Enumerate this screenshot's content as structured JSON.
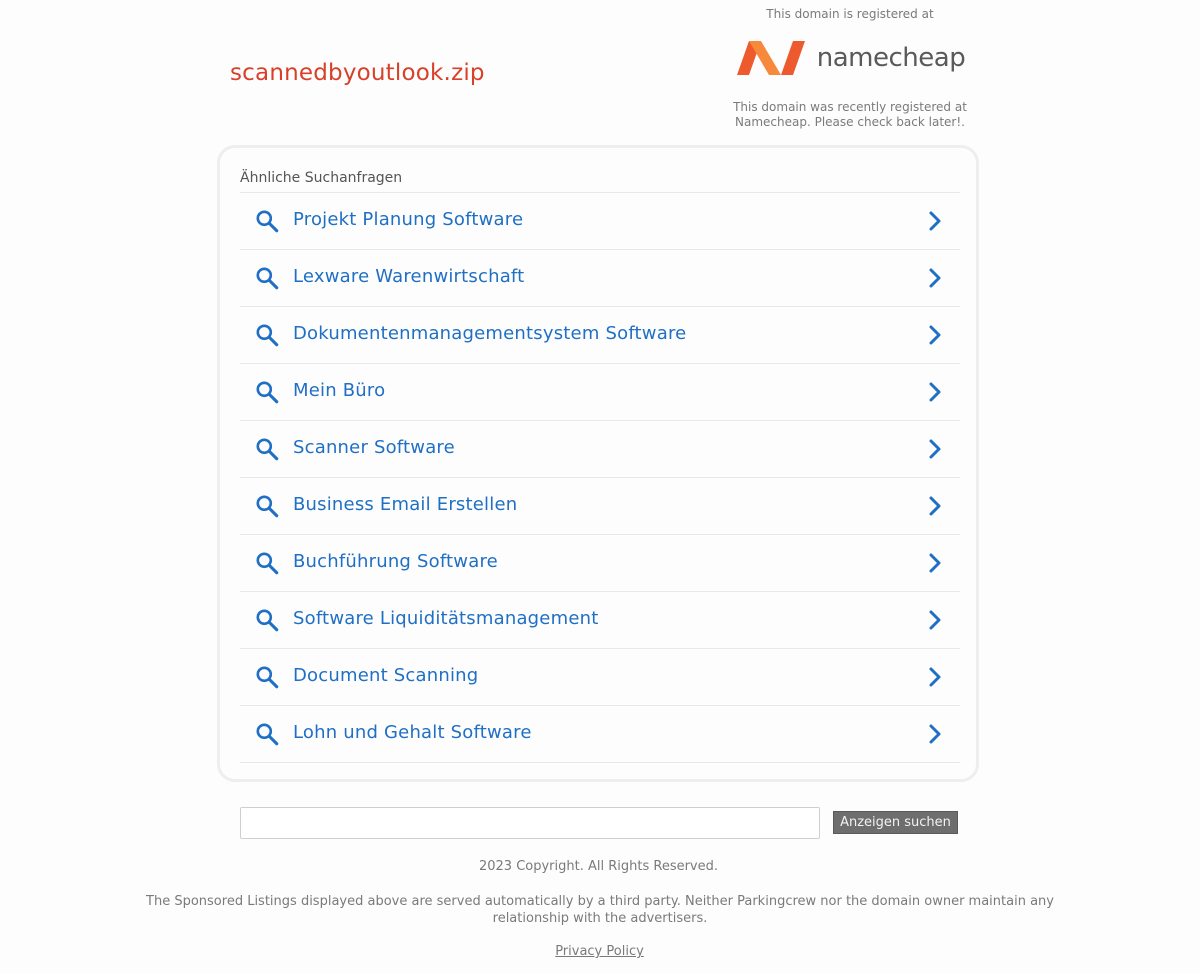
{
  "header": {
    "domain": "scannedbyoutlook.zip"
  },
  "registrar": {
    "registered_at_text": "This domain is registered at",
    "logo_text": "namecheap",
    "note_line1": "This domain was recently registered at",
    "note_line2": "Namecheap. Please check back later!.",
    "logo_color": "#f26534"
  },
  "related": {
    "heading": "Ähnliche Suchanfragen",
    "items": [
      {
        "label": "Projekt Planung Software"
      },
      {
        "label": "Lexware Warenwirtschaft"
      },
      {
        "label": "Dokumentenmanagementsystem Software"
      },
      {
        "label": "Mein Büro"
      },
      {
        "label": "Scanner Software"
      },
      {
        "label": "Business Email Erstellen"
      },
      {
        "label": "Buchführung Software"
      },
      {
        "label": "Software Liquiditätsmanagement"
      },
      {
        "label": "Document Scanning"
      },
      {
        "label": "Lohn und Gehalt Software"
      }
    ],
    "link_color": "#1f6fc5",
    "search_icon": "search-icon",
    "chevron_icon": "chevron-right-icon"
  },
  "search": {
    "input_value": "",
    "button_label": "Anzeigen suchen"
  },
  "footer": {
    "copyright": "2023 Copyright. All Rights Reserved.",
    "disclaimer_line1": "The Sponsored Listings displayed above are served automatically by a third party. Neither Parkingcrew nor the domain owner maintain any",
    "disclaimer_line2": "relationship with the advertisers.",
    "privacy_label": "Privacy Policy"
  }
}
